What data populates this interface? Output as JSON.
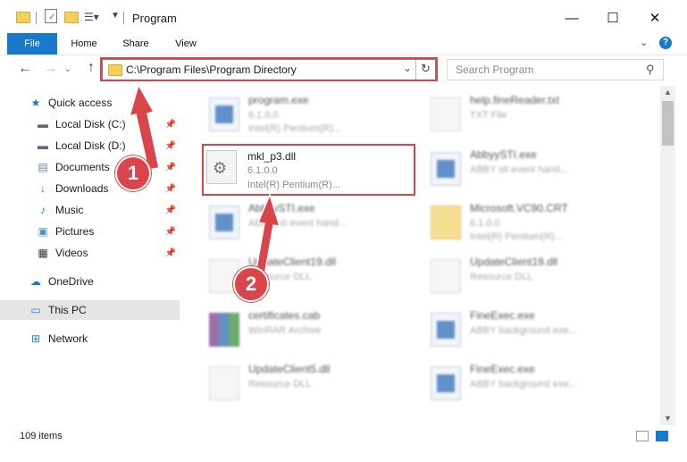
{
  "window": {
    "title": "Program"
  },
  "ribbon": {
    "tabs": [
      "File",
      "Home",
      "Share",
      "View"
    ]
  },
  "address": {
    "path": "C:\\Program Files\\Program Directory"
  },
  "search": {
    "placeholder": "Search Program"
  },
  "sidebar": {
    "quick_access": "Quick access",
    "items": [
      "Local Disk (C:)",
      "Local Disk (D:)",
      "Documents",
      "Downloads",
      "Music",
      "Pictures",
      "Videos"
    ],
    "onedrive": "OneDrive",
    "this_pc": "This PC",
    "network": "Network"
  },
  "files": [
    {
      "name": "program.exe",
      "line2": "6.1.0.0",
      "line3": "Intel(R) Pentium(R)...",
      "icon": "exe-icon"
    },
    {
      "name": "help.fineReader.txt",
      "line2": "TXT File",
      "line3": "",
      "icon": "text-file-icon"
    },
    {
      "name": "mkl_p3.dll",
      "line2": "6.1.0.0",
      "line3": "Intel(R) Pentium(R)...",
      "icon": "dll-gear-icon"
    },
    {
      "name": "AbbyySTI.exe",
      "line2": "ABBY sti event hand...",
      "line3": "",
      "icon": "exe-icon"
    },
    {
      "name": "AbbyySTI.exe",
      "line2": "ABBY sti event hand...",
      "line3": "",
      "icon": "exe-icon"
    },
    {
      "name": "Microsoft.VC90.CRT",
      "line2": "6.1.0.0",
      "line3": "Intel(R) Pentium(R)...",
      "icon": "folder-icon"
    },
    {
      "name": "UpdateClient19.dll",
      "line2": "Resource DLL",
      "line3": "",
      "icon": "dll-gear-icon"
    },
    {
      "name": "UpdateClient19.dll",
      "line2": "Resource DLL",
      "line3": "",
      "icon": "dll-gear-icon"
    },
    {
      "name": "certificates.cab",
      "line2": "WinRAR Archive",
      "line3": "",
      "icon": "winrar-icon"
    },
    {
      "name": "FineExec.exe",
      "line2": "ABBY background exe...",
      "line3": "",
      "icon": "exe-icon"
    },
    {
      "name": "UpdateClient5.dll",
      "line2": "Resource DLL",
      "line3": "",
      "icon": "dll-gear-icon"
    },
    {
      "name": "FineExec.exe",
      "line2": "ABBY background exe...",
      "line3": "",
      "icon": "exe-icon"
    }
  ],
  "status": {
    "items_count": "109 items"
  },
  "annotations": {
    "badge1": "1",
    "badge2": "2"
  },
  "colors": {
    "accent": "#1979ca",
    "highlight": "#d9454b",
    "selected_nav": "#e5e5e5"
  }
}
